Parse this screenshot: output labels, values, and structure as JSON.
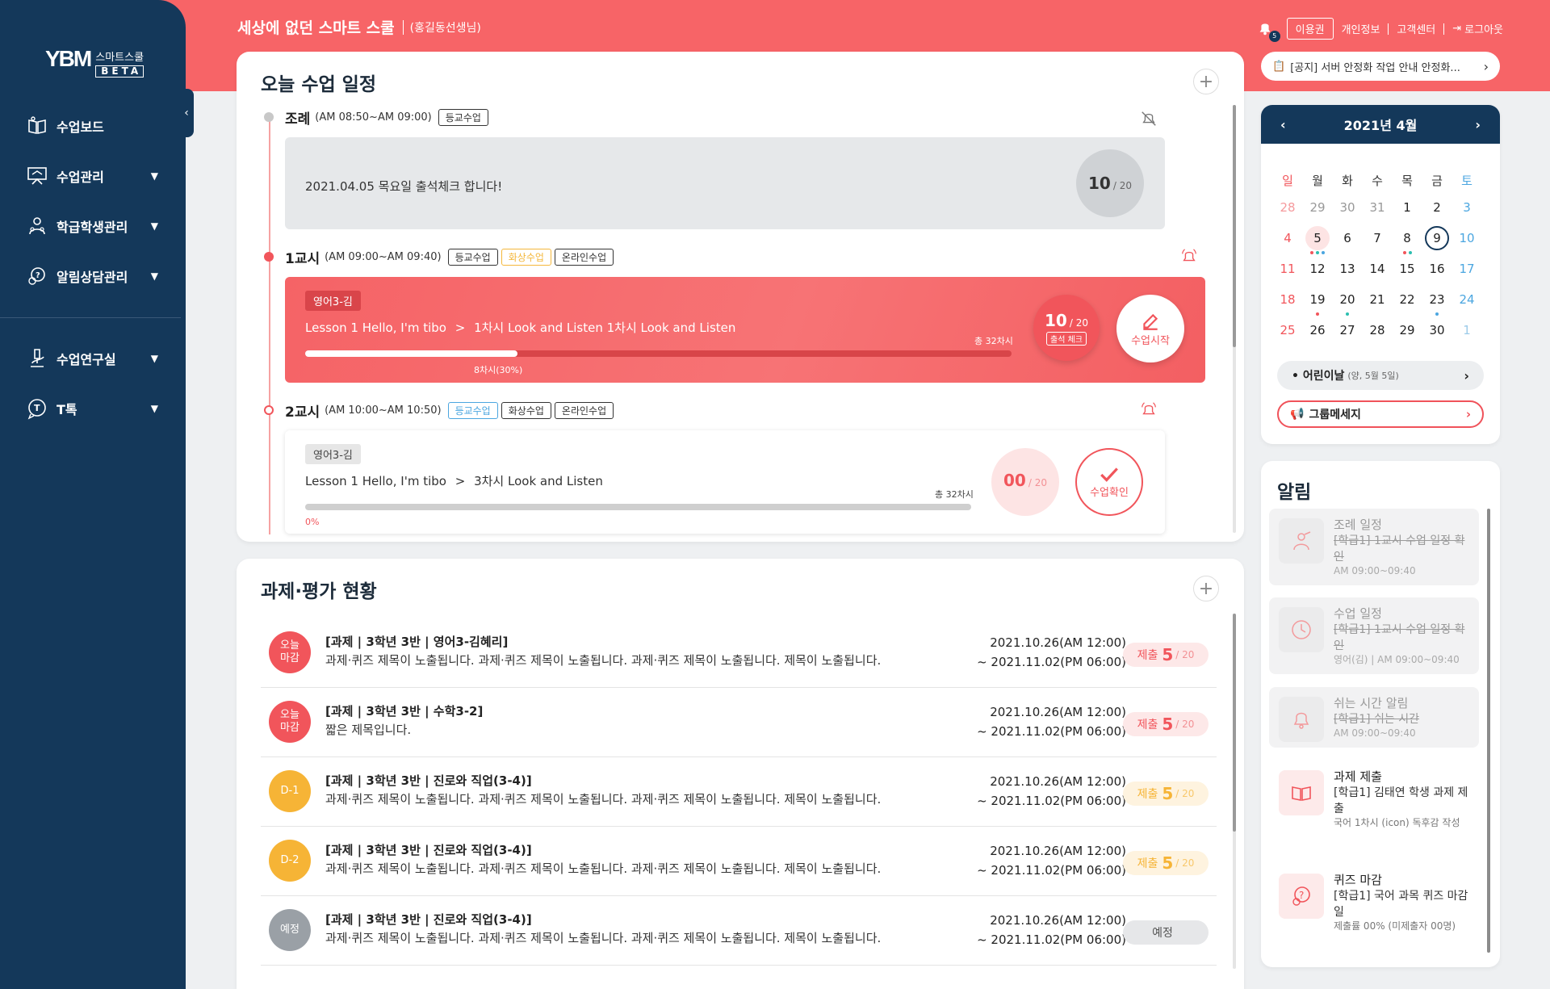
{
  "app": {
    "title": "세상에 없던 스마트 스쿨",
    "user": "(홍길동선생님)",
    "logo_mark": "YBM",
    "logo_name": "스마트스쿨",
    "logo_beta": "BETA"
  },
  "top_nav": {
    "bell_count": "5",
    "usage": "이용권",
    "profile": "개인정보",
    "support": "고객센터",
    "logout": "로그아웃"
  },
  "notice": "[공지] 서버 안정화 작업 안내 안정화...",
  "sidebar": {
    "items": [
      {
        "label": "수업보드",
        "icon": "book-icon",
        "arrow": ""
      },
      {
        "label": "수업관리",
        "icon": "presentation-icon",
        "arrow": "▼"
      },
      {
        "label": "학급학생관리",
        "icon": "students-icon",
        "arrow": "▼"
      },
      {
        "label": "알림상담관리",
        "icon": "chat-icon",
        "arrow": "▼"
      },
      {
        "label": "수업연구실",
        "icon": "microscope-icon",
        "arrow": "▼"
      },
      {
        "label": "T톡",
        "icon": "talk-icon",
        "arrow": "▼"
      }
    ]
  },
  "schedule": {
    "title": "오늘 수업 일정",
    "periods": [
      {
        "name": "조례",
        "time": "(AM 08:50~AM 09:00)",
        "tags": [
          "등교수업"
        ],
        "message": "2021.04.05 목요일 출석체크 합니다!",
        "count": "10",
        "total": "/ 20"
      },
      {
        "name": "1교시",
        "time": "(AM 09:00~AM 09:40)",
        "tags": [
          "등교수업",
          "화상수업",
          "온라인수업"
        ],
        "class": "영어3-김",
        "lesson": "Lesson 1 Hello, I'm tibo",
        "sep": ">",
        "chapter": "1차시 Look and Listen 1차시 Look and Listen",
        "total_sessions": "총 32차시",
        "progress": 0.3,
        "progress_label": "8차시(30%)",
        "count": "10",
        "total": "/ 20",
        "count_label": "출석 체크",
        "action": "수업시작"
      },
      {
        "name": "2교시",
        "time": "(AM 10:00~AM 10:50)",
        "tags": [
          "등교수업",
          "화상수업",
          "온라인수업"
        ],
        "class": "영어3-김",
        "lesson": "Lesson 1 Hello, I'm tibo",
        "sep": ">",
        "chapter": "3차시 Look and Listen",
        "total_sessions": "총 32차시",
        "progress": 0,
        "progress_label": "0%",
        "count": "00",
        "total": "/ 20",
        "action": "수업확인"
      }
    ]
  },
  "tasks": {
    "title": "과제·평가 현황",
    "items": [
      {
        "badge": "오늘\n마감",
        "badge_color": "#f1555b",
        "title": "[과제 | 3학년 3반 | 영어3-김혜리]",
        "desc": "과제·퀴즈 제목이 노출됩니다. 과제·퀴즈 제목이 노출됩니다. 과제·퀴즈 제목이 노출됩니다. 제목이 노출됩니다.",
        "start": "2021.10.26(AM 12:00)",
        "end": "~ 2021.11.02(PM 06:00)",
        "submit_label": "제출",
        "submit_count": "5",
        "submit_total": "/ 20",
        "status": "red"
      },
      {
        "badge": "오늘\n마감",
        "badge_color": "#f1555b",
        "title": "[과제 | 3학년 3반 | 수학3-2]",
        "desc": "짧은 제목입니다.",
        "start": "2021.10.26(AM 12:00)",
        "end": "~ 2021.11.02(PM 06:00)",
        "submit_label": "제출",
        "submit_count": "5",
        "submit_total": "/ 20",
        "status": "red"
      },
      {
        "badge": "D-1",
        "badge_color": "#f6b436",
        "title": "[과제 | 3학년 3반 | 진로와 직업(3-4)]",
        "desc": "과제·퀴즈 제목이 노출됩니다. 과제·퀴즈 제목이 노출됩니다. 과제·퀴즈 제목이 노출됩니다. 제목이 노출됩니다.",
        "start": "2021.10.26(AM 12:00)",
        "end": "~ 2021.11.02(PM 06:00)",
        "submit_label": "제출",
        "submit_count": "5",
        "submit_total": "/ 20",
        "status": "yellow"
      },
      {
        "badge": "D-2",
        "badge_color": "#f6b436",
        "title": "[과제 | 3학년 3반 | 진로와 직업(3-4)]",
        "desc": "과제·퀴즈 제목이 노출됩니다. 과제·퀴즈 제목이 노출됩니다. 과제·퀴즈 제목이 노출됩니다. 제목이 노출됩니다.",
        "start": "2021.10.26(AM 12:00)",
        "end": "~ 2021.11.02(PM 06:00)",
        "submit_label": "제출",
        "submit_count": "5",
        "submit_total": "/ 20",
        "status": "yellow"
      },
      {
        "badge": "예정",
        "badge_color": "#9aa0a6",
        "title": "[과제 | 3학년 3반 | 진로와 직업(3-4)]",
        "desc": "과제·퀴즈 제목이 노출됩니다. 과제·퀴즈 제목이 노출됩니다. 과제·퀴즈 제목이 노출됩니다. 제목이 노출됩니다.",
        "start": "2021.10.26(AM 12:00)",
        "end": "~ 2021.11.02(PM 06:00)",
        "submit_label": "예정",
        "submit_count": "",
        "submit_total": "",
        "status": "gray"
      }
    ]
  },
  "calendar": {
    "title": "2021년 4월",
    "weekdays": [
      "일",
      "월",
      "화",
      "수",
      "목",
      "금",
      "토"
    ],
    "weeks": [
      [
        "28",
        "29",
        "30",
        "31",
        "1",
        "2",
        "3"
      ],
      [
        "4",
        "5",
        "6",
        "7",
        "8",
        "9",
        "10"
      ],
      [
        "11",
        "12",
        "13",
        "14",
        "15",
        "16",
        "17"
      ],
      [
        "18",
        "19",
        "20",
        "21",
        "22",
        "23",
        "24"
      ],
      [
        "25",
        "26",
        "27",
        "28",
        "29",
        "30",
        "1"
      ]
    ],
    "muted_first_row": 4,
    "today": "9",
    "selected": "5",
    "holiday": "• 어린이날",
    "holiday_sub": "(양, 5월 5일)",
    "group_message": "그룹메세지"
  },
  "alerts": {
    "title": "알림",
    "items": [
      {
        "title": "조례 일정",
        "body": "[학급1] 1교시 수업 일정 확인",
        "meta": "AM 09:00~09:40",
        "icon": "teacher-icon",
        "done": true
      },
      {
        "title": "수업 일정",
        "body": "[학급1] 1교시 수업 일정 확인",
        "meta": "영어(김) | AM 09:00~09:40",
        "icon": "clock-icon",
        "done": true
      },
      {
        "title": "쉬는 시간 알림",
        "body": "[학급1] 쉬는 시간",
        "meta": "AM 09:00~09:40",
        "icon": "bell-icon",
        "done": true
      },
      {
        "title": "과제 제출",
        "body": "[학급1] 김태연 학생 과제 제출",
        "meta": "국어 1차시 (icon) 독후감 작성",
        "icon": "open-book-icon",
        "done": false
      },
      {
        "title": "퀴즈 마감",
        "body": "[학급1] 국어 과목 퀴즈 마감일",
        "meta": "제출률 00% (미제출자 00명)",
        "icon": "quiz-icon",
        "done": false
      }
    ]
  },
  "colors": {
    "brand": "#f76467",
    "navy": "#14385a",
    "red": "#f1555b",
    "yellow": "#f6b436",
    "blue": "#4ba6e0"
  }
}
